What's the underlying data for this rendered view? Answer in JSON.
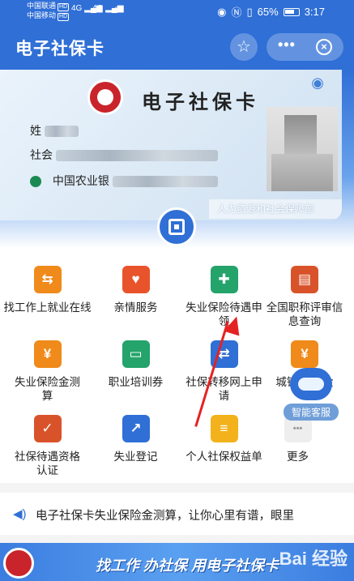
{
  "status_bar": {
    "carrier1": "中国联通",
    "carrier2": "中国移动",
    "hd": "HD",
    "signal1": "4G",
    "signal2": "4G",
    "battery": "65%",
    "time": "3:17"
  },
  "header": {
    "title": "电子社保卡"
  },
  "card": {
    "title": "电子社保卡",
    "name_label": "姓",
    "number_label": "社会",
    "bank_label": "中国农业银",
    "issuer": "人力资源和社会保障部"
  },
  "services": [
    {
      "label": "找工作上就业在线",
      "icon": "handshake-icon",
      "color": "#f08a1a"
    },
    {
      "label": "亲情服务",
      "icon": "heart-plus-icon",
      "color": "#e8532b"
    },
    {
      "label": "失业保险待遇申领",
      "icon": "person-cert-icon",
      "color": "#24a36b"
    },
    {
      "label": "全国职称评审信息查询",
      "icon": "certificate-icon",
      "color": "#d9532a"
    },
    {
      "label": "失业保险金测算",
      "icon": "person-calc-icon",
      "color": "#f08a1a"
    },
    {
      "label": "职业培训券",
      "icon": "ticket-icon",
      "color": "#24a36b"
    },
    {
      "label": "社保转移网上申请",
      "icon": "transfer-icon",
      "color": "#2f6fd6"
    },
    {
      "label": "城镇职工 金",
      "icon": "person-coin-icon",
      "color": "#f08a1a"
    },
    {
      "label": "社保待遇资格认证",
      "icon": "id-verify-icon",
      "color": "#d9532a"
    },
    {
      "label": "失业登记",
      "icon": "person-register-icon",
      "color": "#2f6fd6"
    },
    {
      "label": "个人社保权益单",
      "icon": "document-icon",
      "color": "#f3b21c"
    },
    {
      "label": "更多",
      "icon": "more-icon",
      "color": "#eeeeee"
    }
  ],
  "service_glyphs": [
    "⇆",
    "♥",
    "✚",
    "▤",
    "¥",
    "▭",
    "⇄",
    "¥",
    "✓",
    "↗",
    "≡",
    "•••"
  ],
  "assistant": {
    "label": "智能客服"
  },
  "notice": {
    "text": "电子社保卡失业保险金测算，让你心里有谱，眼里"
  },
  "banner": {
    "text": "找工作 办社保 用电子社保卡",
    "watermark": "Bai 经验"
  }
}
